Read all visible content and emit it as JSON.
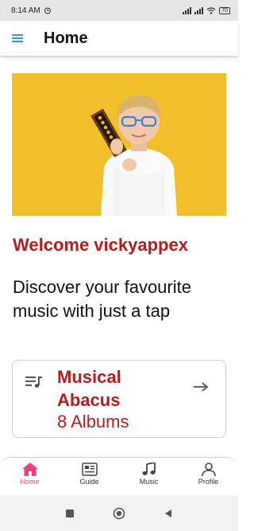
{
  "status_bar": {
    "time": "8:14 AM",
    "battery": "70"
  },
  "app_bar": {
    "title": "Home"
  },
  "welcome": "Welcome vickyappex",
  "tagline": "Discover your favourite music with just a tap",
  "album_card": {
    "title": "Musical Abacus",
    "count": "8 Albums"
  },
  "bottom_nav": [
    {
      "label": "Home",
      "icon": "home-icon",
      "active": true
    },
    {
      "label": "Guide",
      "icon": "guide-icon",
      "active": false
    },
    {
      "label": "Music",
      "icon": "music-note-icon",
      "active": false
    },
    {
      "label": "Profile",
      "icon": "profile-icon",
      "active": false
    }
  ],
  "colors": {
    "accent": "#b71c1c",
    "active_tab": "#ec407a",
    "menu_icon": "#1e88e5",
    "hero_bg": "#f0bf2b"
  }
}
